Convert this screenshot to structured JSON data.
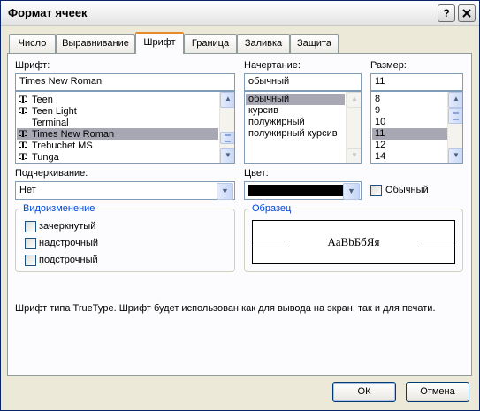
{
  "window": {
    "title": "Формат ячеек",
    "help_button": "?",
    "close_button": "✕"
  },
  "tabs": [
    {
      "label": "Число"
    },
    {
      "label": "Выравнивание"
    },
    {
      "label": "Шрифт",
      "active": true
    },
    {
      "label": "Граница"
    },
    {
      "label": "Заливка"
    },
    {
      "label": "Защита"
    }
  ],
  "font": {
    "label": "Шрифт:",
    "value": "Times New Roman",
    "items": [
      {
        "name": "Teen",
        "truetype": true
      },
      {
        "name": "Teen Light",
        "truetype": true
      },
      {
        "name": "Terminal",
        "truetype": false
      },
      {
        "name": "Times New Roman",
        "truetype": true,
        "selected": true
      },
      {
        "name": "Trebuchet MS",
        "truetype": true
      },
      {
        "name": "Tunga",
        "truetype": true
      }
    ]
  },
  "style": {
    "label": "Начертание:",
    "value": "обычный",
    "items": [
      {
        "name": "обычный",
        "selected": true
      },
      {
        "name": "курсив"
      },
      {
        "name": "полужирный"
      },
      {
        "name": "полужирный курсив"
      }
    ]
  },
  "size": {
    "label": "Размер:",
    "value": "11",
    "items": [
      {
        "name": "8"
      },
      {
        "name": "9"
      },
      {
        "name": "10"
      },
      {
        "name": "11",
        "selected": true
      },
      {
        "name": "12"
      },
      {
        "name": "14"
      }
    ]
  },
  "underline": {
    "label": "Подчеркивание:",
    "value": "Нет"
  },
  "color": {
    "label": "Цвет:",
    "value_hex": "#000000",
    "normal_label": "Обычный",
    "normal_checked": false
  },
  "effects": {
    "title": "Видоизменение",
    "items": [
      {
        "label": "зачеркнутый",
        "checked": false
      },
      {
        "label": "надстрочный",
        "checked": false
      },
      {
        "label": "подстрочный",
        "checked": false
      }
    ]
  },
  "preview": {
    "title": "Образец",
    "sample": "АаВbБбЯя"
  },
  "description": "Шрифт типа TrueType. Шрифт будет использован как для вывода на экран, так и для печати.",
  "buttons": {
    "ok": "ОК",
    "cancel": "Отмена"
  },
  "colors": {
    "active_tab_accent": "#e68b2c",
    "group_title": "#0046d5",
    "selection": "#a8a8b5"
  }
}
